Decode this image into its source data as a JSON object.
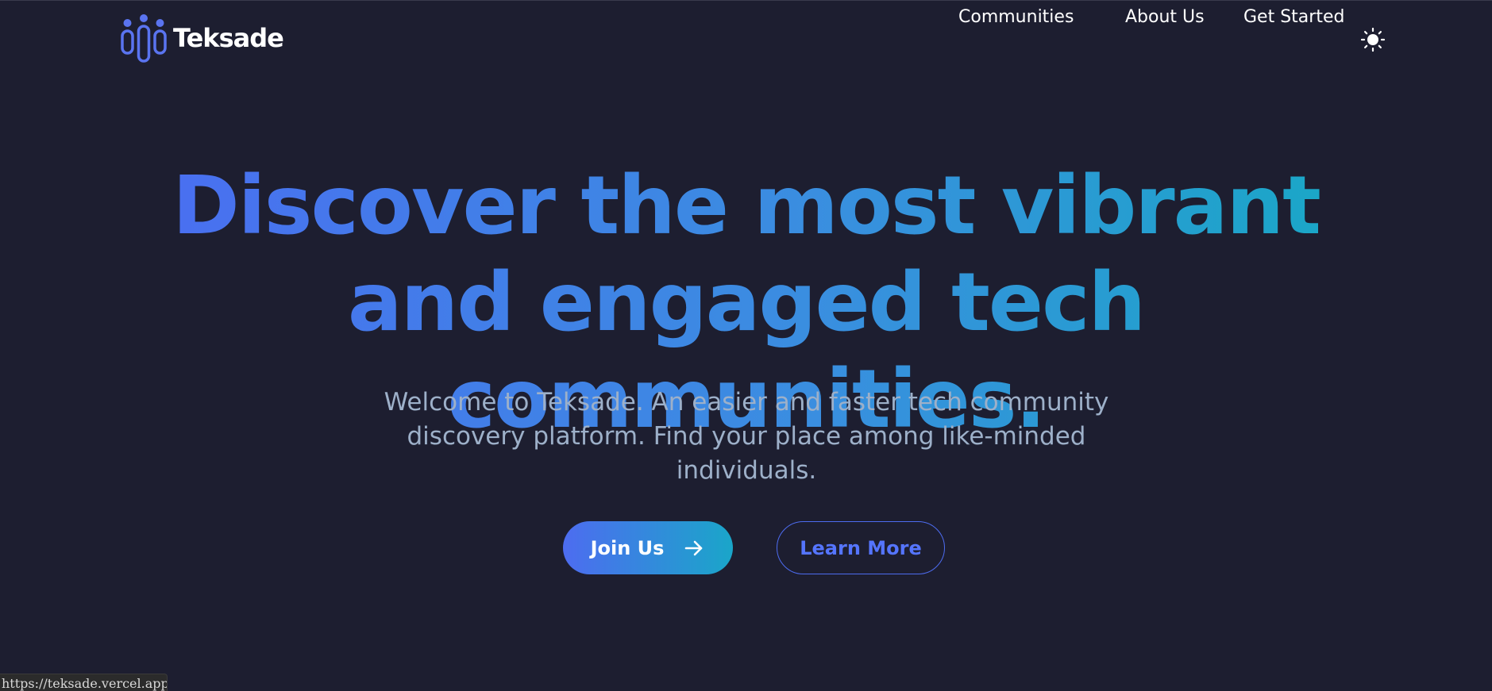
{
  "brand": {
    "name": "Teksade",
    "logo_icon": "people-group-icon",
    "accent": "#4d6cf0"
  },
  "nav": {
    "links": [
      {
        "label": "Communities"
      },
      {
        "label": "About Us"
      },
      {
        "label": "Get Started"
      }
    ],
    "theme_toggle_icon": "sun-icon"
  },
  "hero": {
    "title": "Discover the most vibrant and engaged tech communities.",
    "subtitle": "Welcome to Teksade. An easier and faster tech community discovery platform. Find your place among like-minded individuals.",
    "primary_button": {
      "label": "Join Us",
      "icon": "arrow-right-icon"
    },
    "secondary_button": {
      "label": "Learn More"
    },
    "gradient": [
      "#4b6cf2",
      "#16aac4"
    ]
  },
  "status_bar": {
    "url": "https://teksade.vercel.app"
  }
}
